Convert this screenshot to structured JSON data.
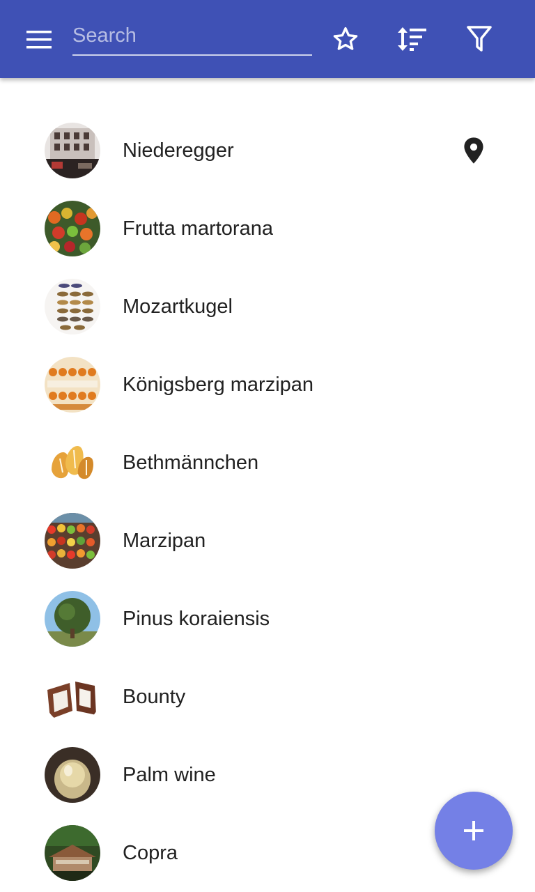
{
  "toolbar": {
    "search_placeholder": "Search",
    "icons": [
      "menu-icon",
      "star-outline-icon",
      "sort-icon",
      "filter-icon"
    ],
    "color": "#3f51b5"
  },
  "items": [
    {
      "label": "Niederegger",
      "has_location": true
    },
    {
      "label": "Frutta martorana",
      "has_location": false
    },
    {
      "label": "Mozartkugel",
      "has_location": false
    },
    {
      "label": "Königsberg marzipan",
      "has_location": false
    },
    {
      "label": "Bethmännchen",
      "has_location": false
    },
    {
      "label": "Marzipan",
      "has_location": false
    },
    {
      "label": "Pinus koraiensis",
      "has_location": false
    },
    {
      "label": "Bounty",
      "has_location": false
    },
    {
      "label": "Palm wine",
      "has_location": false
    },
    {
      "label": "Copra",
      "has_location": false
    }
  ],
  "fab": {
    "icon": "plus-icon",
    "color": "#7480e6"
  }
}
